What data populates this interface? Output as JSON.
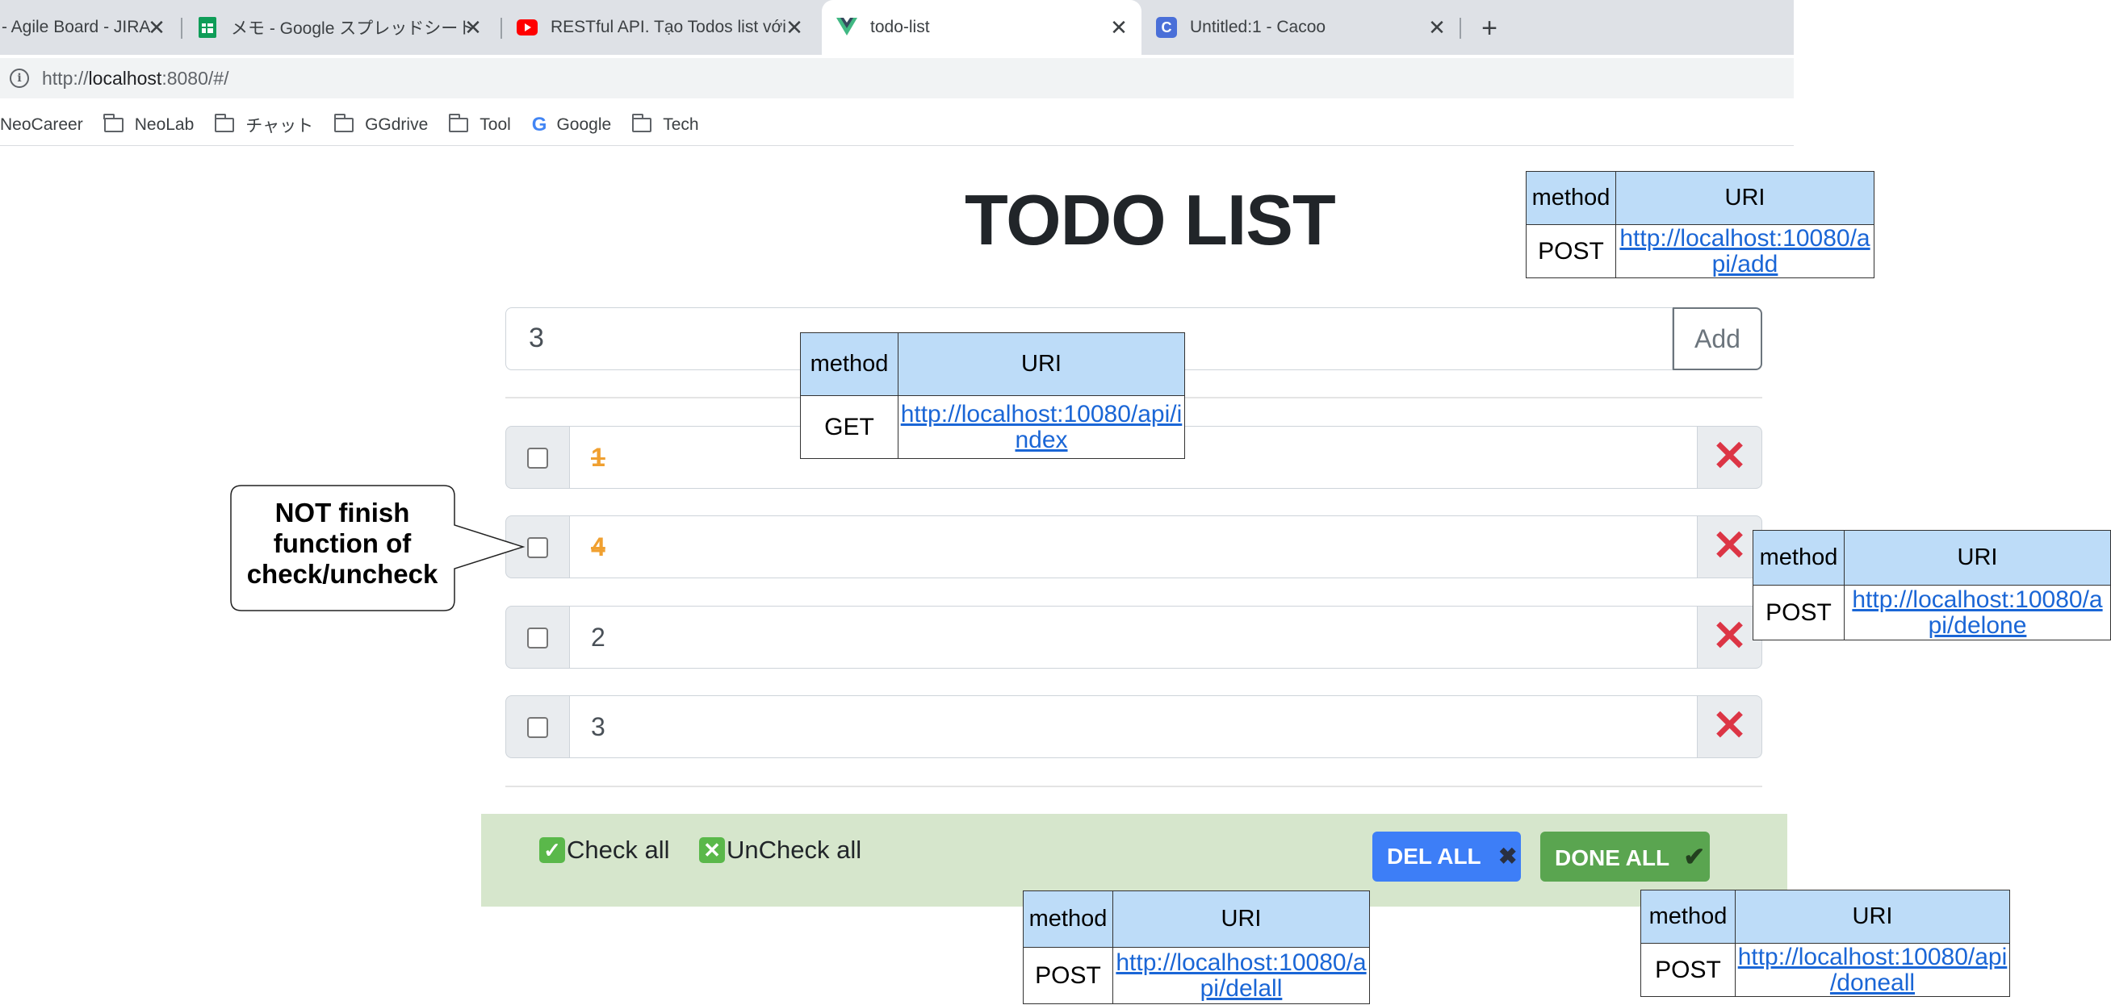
{
  "browser": {
    "tabs": [
      {
        "label": "- Agile Board - JIRA",
        "icon": "jira-icon",
        "active": false
      },
      {
        "label": "メモ - Google スプレッドシート",
        "icon": "google-sheets-icon",
        "active": false
      },
      {
        "label": "RESTful API. Tạo Todos list với",
        "icon": "youtube-icon",
        "active": false
      },
      {
        "label": "todo-list",
        "icon": "vue-icon",
        "active": true
      },
      {
        "label": "Untitled:1 - Cacoo",
        "icon": "cacoo-icon",
        "active": false
      }
    ],
    "new_tab_label": "+",
    "close_glyph": "✕",
    "address": {
      "prefix": "http://",
      "host": "localhost",
      "rest": ":8080/#/"
    },
    "bookmarks": [
      {
        "label": "NeoCareer",
        "icon": "none"
      },
      {
        "label": "NeoLab",
        "icon": "folder-icon"
      },
      {
        "label": "チャット",
        "icon": "folder-icon"
      },
      {
        "label": "GGdrive",
        "icon": "folder-icon"
      },
      {
        "label": "Tool",
        "icon": "folder-icon"
      },
      {
        "label": "Google",
        "icon": "google-icon"
      },
      {
        "label": "Tech",
        "icon": "folder-icon"
      }
    ]
  },
  "app": {
    "title": "TODO LIST",
    "input_value": "3",
    "add_label": "Add",
    "items": [
      {
        "text": "1",
        "done": true
      },
      {
        "text": "4",
        "done": true
      },
      {
        "text": "2",
        "done": false
      },
      {
        "text": "3",
        "done": false
      }
    ],
    "delete_glyph": "✕",
    "check_all_label": "Check all",
    "uncheck_all_label": "UnCheck all",
    "check_glyph": "✓",
    "uncheck_glyph": "✕",
    "del_all_label": "DEL ALL",
    "del_all_glyph": "✖",
    "done_all_label": "DONE ALL",
    "done_all_glyph": "✔"
  },
  "annotations": {
    "callout_text": "NOT finish function of check/uncheck",
    "header_method": "method",
    "header_uri": "URI",
    "add_api": {
      "method": "POST",
      "uri_line1": "http://localhost:10080/a",
      "uri_line2": "pi/add"
    },
    "index_api": {
      "method": "GET",
      "uri_line1": "http://localhost:10080/api/i",
      "uri_line2": "ndex"
    },
    "delone_api": {
      "method": "POST",
      "uri_line1": "http://localhost:10080/a",
      "uri_line2": "pi/delone"
    },
    "delall_api": {
      "method": "POST",
      "uri_line1": "http://localhost:10080/a",
      "uri_line2": "pi/delall"
    },
    "doneall_api": {
      "method": "POST",
      "uri_line1": "http://localhost:10080/api",
      "uri_line2": "/doneall"
    }
  },
  "colors": {
    "tabstrip": "#dee1e6",
    "footer": "#d6e6cc",
    "del_all_button": "#3d7ef7",
    "done_all_button": "#5aa550",
    "delete_x": "#dc3545",
    "done_text": "#f0a030",
    "table_header": "#bddcf8",
    "link": "#1a66d6"
  }
}
